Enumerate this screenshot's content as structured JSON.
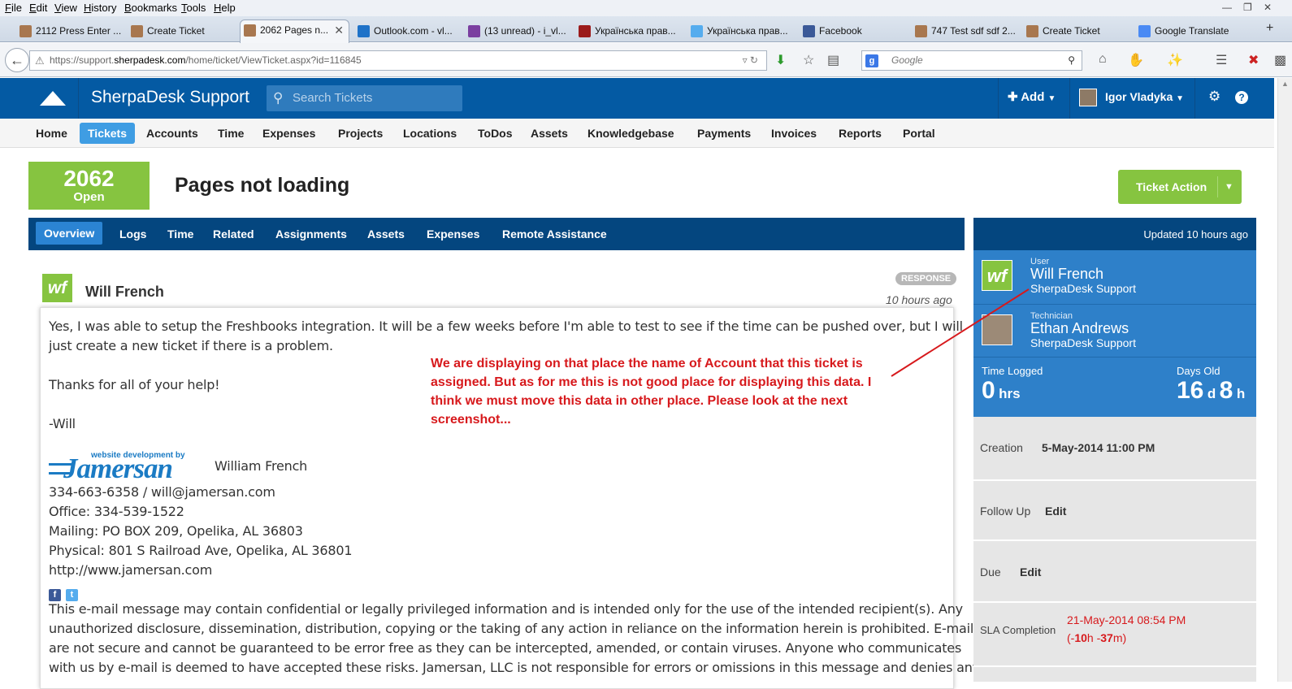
{
  "browser": {
    "menu": [
      "File",
      "Edit",
      "View",
      "History",
      "Bookmarks",
      "Tools",
      "Help"
    ],
    "tabs": [
      {
        "label": "2112 Press Enter ..."
      },
      {
        "label": "Create Ticket"
      },
      {
        "label": "2062 Pages n..."
      },
      {
        "label": "Outlook.com - vl..."
      },
      {
        "label": "(13 unread) - i_vl..."
      },
      {
        "label": "Українська прав..."
      },
      {
        "label": "Українська прав..."
      },
      {
        "label": "Facebook"
      },
      {
        "label": "747 Test sdf sdf 2..."
      },
      {
        "label": "Create Ticket"
      },
      {
        "label": "Google Translate"
      }
    ],
    "url_prefix": "https://support.",
    "url_domain": "sherpadesk.com",
    "url_path": "/home/ticket/ViewTicket.aspx?id=116845",
    "search_placeholder": "Google"
  },
  "app": {
    "brand": "SherpaDesk Support",
    "search_placeholder": "Search Tickets",
    "add_label": "Add",
    "user_name": "Igor Vladyka"
  },
  "nav": [
    "Home",
    "Tickets",
    "Accounts",
    "Time",
    "Expenses",
    "Projects",
    "Locations",
    "ToDos",
    "Assets",
    "Knowledgebase",
    "Payments",
    "Invoices",
    "Reports",
    "Portal"
  ],
  "ticket": {
    "number": "2062",
    "status": "Open",
    "title": "Pages not loading",
    "action_label": "Ticket Action"
  },
  "subtabs": [
    "Overview",
    "Logs",
    "Time",
    "Related",
    "Assignments",
    "Assets",
    "Expenses",
    "Remote Assistance"
  ],
  "response": {
    "author": "Will French",
    "badge": "RESPONSE",
    "ago": "10 hours ago",
    "line1": "Yes, I was able to setup the Freshbooks integration.  It will be a few weeks before I'm able to test to see if the time can be pushed over, but I will",
    "line2": "just create a new ticket if there is a problem.",
    "line3": "Thanks for all of your help!",
    "line4": "-Will",
    "logo_tagline": "website development by",
    "logo_word": "Jamersan",
    "sig_name": "William French",
    "sig_phone": "334-663-6358 / will@jamersan.com",
    "sig_office": "Office: 334-539-1522",
    "sig_mailing": "Mailing: PO BOX 209, Opelika, AL 36803",
    "sig_physical": "Physical: 801 S Railroad Ave, Opelika, AL 36801",
    "sig_web": "http://www.jamersan.com",
    "disc1": "This e-mail message may contain confidential or legally privileged information and is intended only for the use of the intended recipient(s). Any",
    "disc2": "unauthorized disclosure, dissemination, distribution, copying or the taking of any action in reliance on the information herein is prohibited. E-mails",
    "disc3": "are not secure and cannot be guaranteed to be error free as they can be intercepted, amended, or contain viruses. Anyone who communicates",
    "disc4": "with us by e-mail is deemed to have accepted these risks. Jamersan, LLC is not responsible for errors or omissions in this message and denies any"
  },
  "annotation": {
    "line1": "We are displaying on that place the name of Account that this ticket is",
    "line2": "assigned. But as for me this is not good place for displaying this data. I",
    "line3": "think we must move this data in other place. Please look at the next",
    "line4": "screenshot..."
  },
  "sidebar": {
    "updated": "Updated 10 hours ago",
    "user_role": "User",
    "user_name": "Will French",
    "user_org": "SherpaDesk Support",
    "tech_role": "Technician",
    "tech_name": "Ethan Andrews",
    "tech_org": "SherpaDesk Support",
    "time_logged_label": "Time Logged",
    "time_logged_value": "0",
    "time_logged_unit": "hrs",
    "days_old_label": "Days Old",
    "days_old_d": "16",
    "days_old_d_unit": "d",
    "days_old_h": "8",
    "days_old_h_unit": "h",
    "creation_label": "Creation",
    "creation_value": "5-May-2014 11:00 PM",
    "followup_label": "Follow Up",
    "followup_value": "Edit",
    "due_label": "Due",
    "due_value": "Edit",
    "sla_label": "SLA Completion",
    "sla_value": "21-May-2014 08:54 PM",
    "sla_overdue_open": "(-",
    "sla_overdue_h": "10",
    "sla_overdue_h_unit": "h -",
    "sla_overdue_m": "37",
    "sla_overdue_m_unit": "m)"
  },
  "colors": {
    "header_blue": "#045aa3",
    "green": "#86c440",
    "annotation_red": "#d7191c"
  }
}
